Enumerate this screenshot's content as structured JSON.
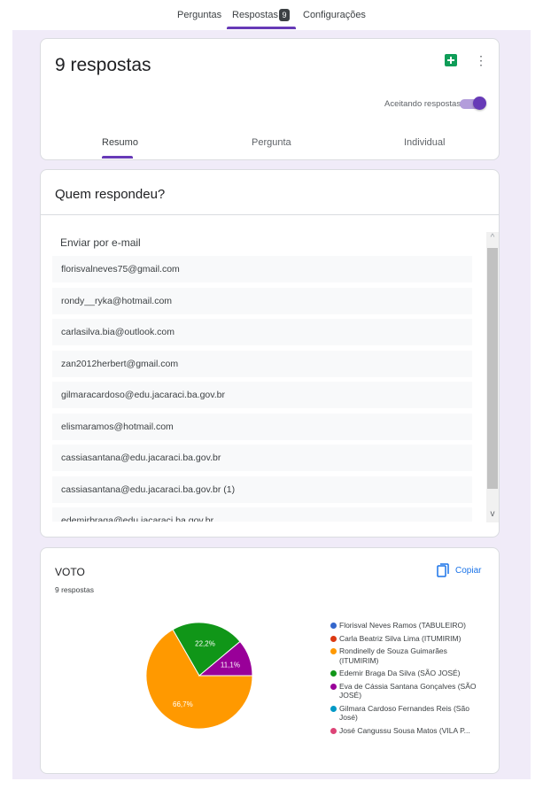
{
  "nav": {
    "tabs": [
      {
        "label": "Perguntas"
      },
      {
        "label": "Respostas",
        "badge": "9"
      },
      {
        "label": "Configurações"
      }
    ]
  },
  "summary": {
    "title": "9 respostas",
    "accepting_label": "Aceitando respostas",
    "accepting": true,
    "tabs": [
      {
        "label": "Resumo"
      },
      {
        "label": "Pergunta"
      },
      {
        "label": "Individual"
      }
    ]
  },
  "respondents": {
    "title": "Quem respondeu?",
    "list_header": "Enviar por e-mail",
    "emails": [
      "florisvalneves75@gmail.com",
      "rondy__ryka@hotmail.com",
      "carlasilva.bia@outlook.com",
      "zan2012herbert@gmail.com",
      "gilmaracardoso@edu.jacaraci.ba.gov.br",
      "elismaramos@hotmail.com",
      "cassiasantana@edu.jacaraci.ba.gov.br",
      "cassiasantana@edu.jacaraci.ba.gov.br (1)",
      "edemirbraga@edu.jacaraci.ba.gov.br"
    ]
  },
  "voto": {
    "title": "VOTO",
    "count": "9 respostas",
    "copy_label": "Copiar"
  },
  "chart_data": {
    "type": "pie",
    "title": "VOTO",
    "slices": [
      {
        "label": "Rondinelly de Souza Guimarães (ITUMIRIM)",
        "value": 66.7,
        "text": "66,7%",
        "color": "#ff9900"
      },
      {
        "label": "Edemir Braga Da Silva (SÃO JOSÉ)",
        "value": 22.2,
        "text": "22,2%",
        "color": "#109618"
      },
      {
        "label": "Eva de Cássia Santana Gonçalves (SÃO JOSÉ)",
        "value": 11.1,
        "text": "11,1%",
        "color": "#990099"
      }
    ],
    "legend": [
      {
        "label": "Florisval Neves Ramos (TABULEIRO)",
        "color": "#3366cc"
      },
      {
        "label": "Carla Beatriz Silva Lima (ITUMIRIM)",
        "color": "#dc3912"
      },
      {
        "label": "Rondinelly de Souza Guimarães (ITUMIRIM)",
        "color": "#ff9900"
      },
      {
        "label": "Edemir Braga Da Silva (SÃO JOSÉ)",
        "color": "#109618"
      },
      {
        "label": "Eva de Cássia Santana Gonçalves (SÃO JOSÉ)",
        "color": "#990099"
      },
      {
        "label": "Gilmara Cardoso Fernandes Reis (São José)",
        "color": "#0099c6"
      },
      {
        "label": "José Cangussu Sousa Matos (VILA P...",
        "color": "#dd4477"
      }
    ],
    "legend_position": "right"
  }
}
